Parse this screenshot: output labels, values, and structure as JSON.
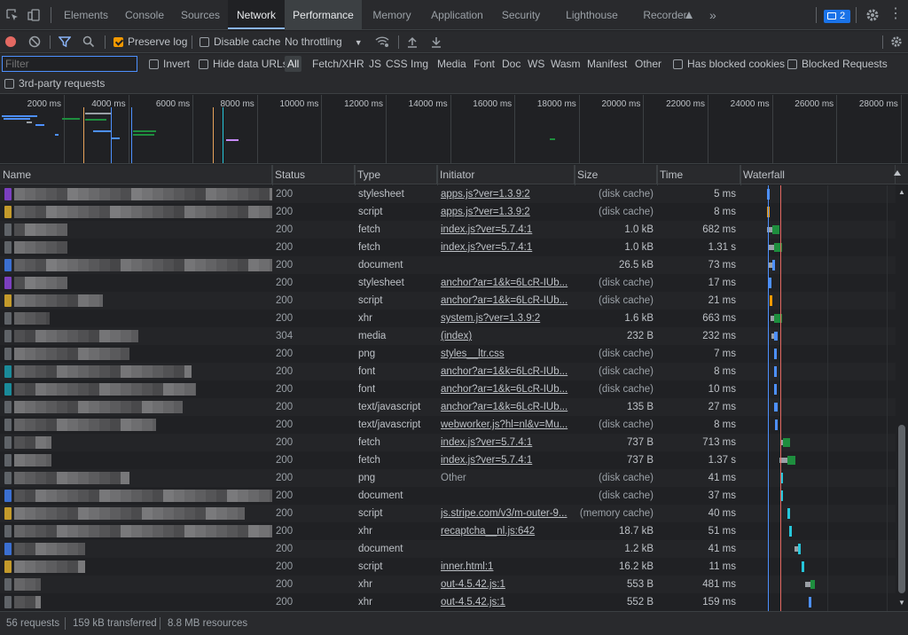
{
  "tabs": [
    {
      "label": "Elements",
      "active": false
    },
    {
      "label": "Console",
      "active": false
    },
    {
      "label": "Sources",
      "active": false
    },
    {
      "label": "Network",
      "active": true
    },
    {
      "label": "Performance",
      "active": false
    },
    {
      "label": "Memory",
      "active": false
    },
    {
      "label": "Application",
      "active": false
    },
    {
      "label": "Security",
      "active": false
    },
    {
      "label": "Lighthouse",
      "active": false
    },
    {
      "label": "Recorder",
      "active": false
    }
  ],
  "issues_count": "2",
  "toolbar": {
    "preserve_log": "Preserve log",
    "disable_cache": "Disable cache",
    "throttling": "No throttling"
  },
  "filterbar": {
    "placeholder": "Filter",
    "invert": "Invert",
    "hide_data_urls": "Hide data URLs",
    "types": [
      "All",
      "Fetch/XHR",
      "JS",
      "CSS",
      "Img",
      "Media",
      "Font",
      "Doc",
      "WS",
      "Wasm",
      "Manifest",
      "Other"
    ],
    "has_blocked_cookies": "Has blocked cookies",
    "blocked_requests": "Blocked Requests",
    "third_party": "3rd-party requests"
  },
  "overview_ticks": [
    "2000 ms",
    "4000 ms",
    "6000 ms",
    "8000 ms",
    "10000 ms",
    "12000 ms",
    "14000 ms",
    "16000 ms",
    "18000 ms",
    "20000 ms",
    "22000 ms",
    "24000 ms",
    "26000 ms",
    "28000 ms"
  ],
  "columns": [
    "Name",
    "Status",
    "Type",
    "Initiator",
    "Size",
    "Time",
    "Waterfall"
  ],
  "rows": [
    {
      "chip": "#7b3fbf",
      "status": "200",
      "type": "stylesheet",
      "initiator": "apps.js?ver=1.3.9:2",
      "initiator_link": true,
      "size": "(disk cache)",
      "time": "5 ms"
    },
    {
      "chip": "#c39a2b",
      "status": "200",
      "type": "script",
      "initiator": "apps.js?ver=1.3.9:2",
      "initiator_link": true,
      "size": "(disk cache)",
      "time": "8 ms"
    },
    {
      "chip": "",
      "status": "200",
      "type": "fetch",
      "initiator": "index.js?ver=5.7.4:1",
      "initiator_link": true,
      "size": "1.0 kB",
      "time": "682 ms"
    },
    {
      "chip": "",
      "status": "200",
      "type": "fetch",
      "initiator": "index.js?ver=5.7.4:1",
      "initiator_link": true,
      "size": "1.0 kB",
      "time": "1.31 s"
    },
    {
      "chip": "#3b6fd1",
      "status": "200",
      "type": "document",
      "initiator": "",
      "initiator_link": false,
      "size": "26.5 kB",
      "time": "73 ms"
    },
    {
      "chip": "#7b3fbf",
      "status": "200",
      "type": "stylesheet",
      "initiator": "anchor?ar=1&k=6LcR-IUb...",
      "initiator_link": true,
      "size": "(disk cache)",
      "time": "17 ms"
    },
    {
      "chip": "#c39a2b",
      "status": "200",
      "type": "script",
      "initiator": "anchor?ar=1&k=6LcR-IUb...",
      "initiator_link": true,
      "size": "(disk cache)",
      "time": "21 ms"
    },
    {
      "chip": "",
      "status": "200",
      "type": "xhr",
      "initiator": "system.js?ver=1.3.9:2",
      "initiator_link": true,
      "size": "1.6 kB",
      "time": "663 ms"
    },
    {
      "chip": "",
      "status": "304",
      "type": "media",
      "initiator": "(index)",
      "initiator_link": true,
      "size": "232 B",
      "time": "232 ms"
    },
    {
      "chip": "",
      "status": "200",
      "type": "png",
      "initiator": "styles__ltr.css",
      "initiator_link": true,
      "size": "(disk cache)",
      "time": "7 ms"
    },
    {
      "chip": "#1a8a99",
      "status": "200",
      "type": "font",
      "initiator": "anchor?ar=1&k=6LcR-IUb...",
      "initiator_link": true,
      "size": "(disk cache)",
      "time": "8 ms"
    },
    {
      "chip": "#1a8a99",
      "status": "200",
      "type": "font",
      "initiator": "anchor?ar=1&k=6LcR-IUb...",
      "initiator_link": true,
      "size": "(disk cache)",
      "time": "10 ms"
    },
    {
      "chip": "",
      "status": "200",
      "type": "text/javascript",
      "initiator": "anchor?ar=1&k=6LcR-IUb...",
      "initiator_link": true,
      "size": "135 B",
      "time": "27 ms"
    },
    {
      "chip": "",
      "status": "200",
      "type": "text/javascript",
      "initiator": "webworker.js?hl=nl&v=Mu...",
      "initiator_link": true,
      "size": "(disk cache)",
      "time": "8 ms"
    },
    {
      "chip": "",
      "status": "200",
      "type": "fetch",
      "initiator": "index.js?ver=5.7.4:1",
      "initiator_link": true,
      "size": "737 B",
      "time": "713 ms"
    },
    {
      "chip": "",
      "status": "200",
      "type": "fetch",
      "initiator": "index.js?ver=5.7.4:1",
      "initiator_link": true,
      "size": "737 B",
      "time": "1.37 s"
    },
    {
      "chip": "",
      "status": "200",
      "type": "png",
      "initiator": "Other",
      "initiator_link": false,
      "size": "(disk cache)",
      "time": "41 ms"
    },
    {
      "chip": "#3b6fd1",
      "status": "200",
      "type": "document",
      "initiator": "",
      "initiator_link": false,
      "size": "(disk cache)",
      "time": "37 ms"
    },
    {
      "chip": "#c39a2b",
      "status": "200",
      "type": "script",
      "initiator": "js.stripe.com/v3/m-outer-9...",
      "initiator_link": true,
      "size": "(memory cache)",
      "time": "40 ms"
    },
    {
      "chip": "",
      "status": "200",
      "type": "xhr",
      "initiator": "recaptcha__nl.js:642",
      "initiator_link": true,
      "size": "18.7 kB",
      "time": "51 ms"
    },
    {
      "chip": "#3b6fd1",
      "status": "200",
      "type": "document",
      "initiator": "",
      "initiator_link": false,
      "size": "1.2 kB",
      "time": "41 ms"
    },
    {
      "chip": "#c39a2b",
      "status": "200",
      "type": "script",
      "initiator": "inner.html:1",
      "initiator_link": true,
      "size": "16.2 kB",
      "time": "11 ms"
    },
    {
      "chip": "",
      "status": "200",
      "type": "xhr",
      "initiator": "out-4.5.42.js:1",
      "initiator_link": true,
      "size": "553 B",
      "time": "481 ms"
    },
    {
      "chip": "",
      "status": "200",
      "type": "xhr",
      "initiator": "out-4.5.42.js:1",
      "initiator_link": true,
      "size": "552 B",
      "time": "159 ms"
    }
  ],
  "status": {
    "requests": "56 requests",
    "transferred": "159 kB transferred",
    "resources": "8.8 MB resources"
  }
}
